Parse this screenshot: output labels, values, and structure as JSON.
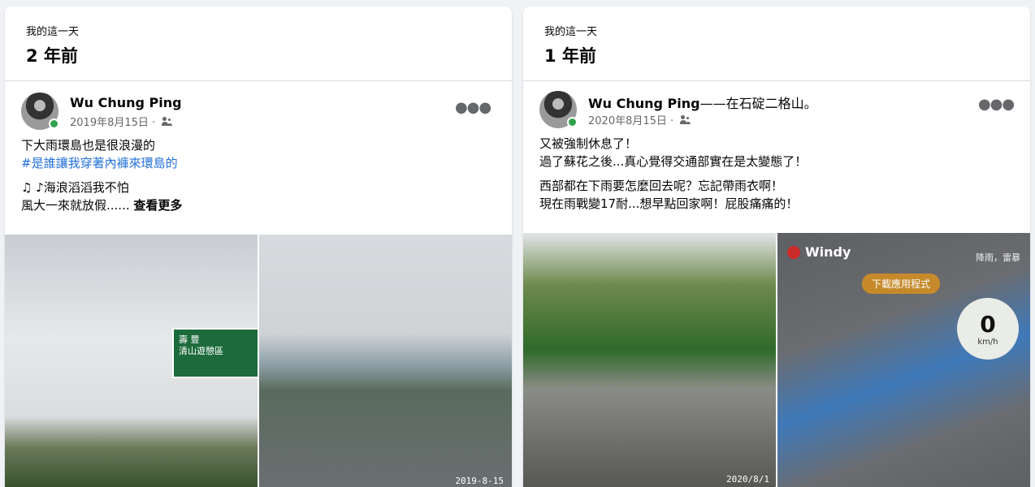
{
  "cards": [
    {
      "memory_label": "我的這一天",
      "years_ago": "2 年前",
      "author": "Wu Chung Ping",
      "author_suffix": "",
      "date": "2019年8月15日 ·",
      "text_lines": [
        "下大雨環島也是很浪漫的"
      ],
      "hashtag": "#是誰讓我穿著內褲來環島的",
      "text_lines2": [
        "♫ ♪海浪滔滔我不怕"
      ],
      "last_line": "風大一來就放假......",
      "see_more": "查看更多",
      "photo_date": "2019-8-15"
    },
    {
      "memory_label": "我的這一天",
      "years_ago": "1 年前",
      "author": "Wu Chung Ping",
      "author_suffix": "——在石碇二格山。",
      "date": "2020年8月15日 ·",
      "text_lines": [
        "又被強制休息了！",
        "過了蘇花之後...真心覺得交通部實在是太變態了！"
      ],
      "text_lines2": [
        "西部都在下雨要怎麼回去呢？忘記帶雨衣啊！",
        "現在雨戰變17耐...想早點回家啊！屁股痛痛的！"
      ],
      "photo_date": "2020/8/1",
      "windy": {
        "brand": "Windy",
        "download_label": "下載應用程式",
        "layer_label": "降雨，雷暴",
        "wind_speed": "0",
        "wind_unit": "km/h"
      }
    }
  ],
  "road_sign": {
    "line1": "壽 豐",
    "line2": "清山遊憩區"
  },
  "icons": [
    "friends-icon",
    "more-options-icon"
  ],
  "colors": {
    "hashtag": "#216fdb",
    "online": "#31a24c",
    "meta": "#65676b"
  }
}
